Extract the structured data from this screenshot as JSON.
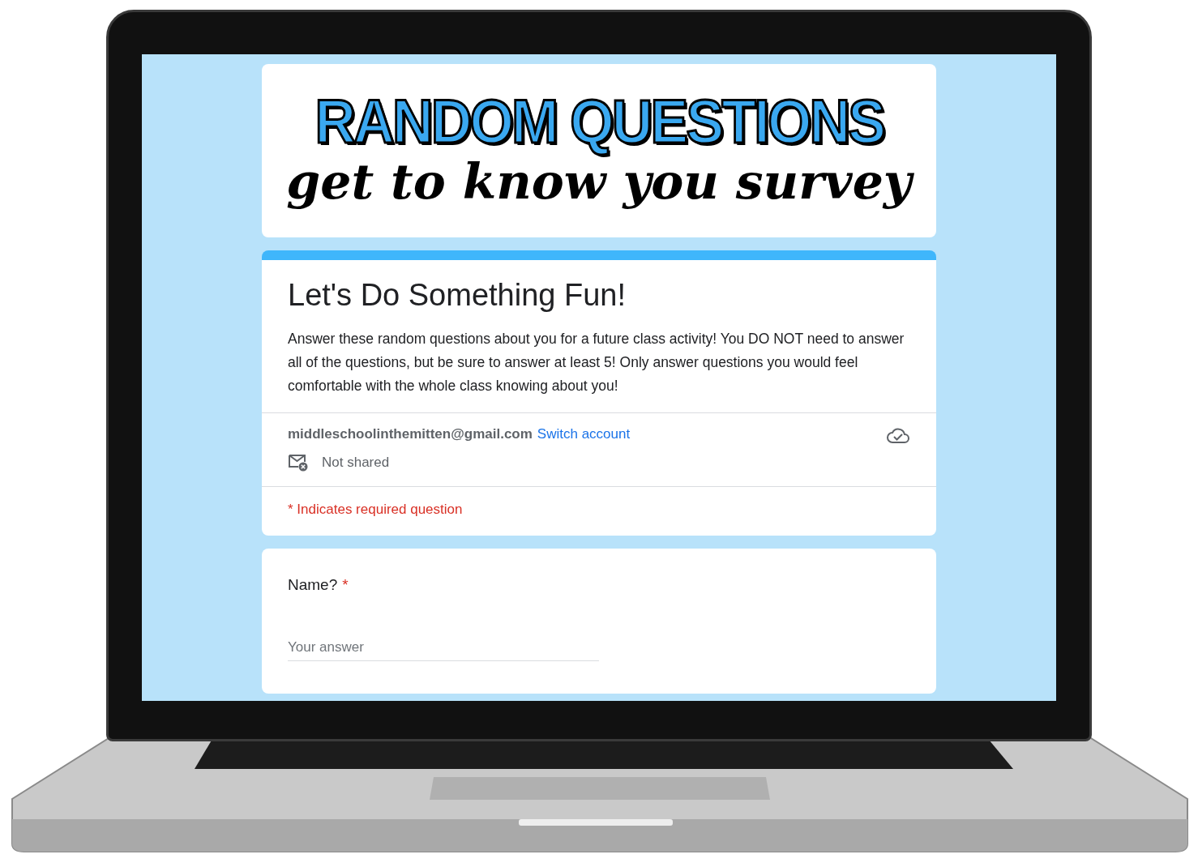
{
  "banner": {
    "title": "RANDOM QUESTIONS",
    "subtitle": "get to know you survey"
  },
  "form": {
    "title": "Let's Do Something Fun!",
    "description": "Answer these random questions about you for a future class activity! You DO NOT need to answer all of the questions, but be sure to answer at least 5! Only answer questions you would feel comfortable with the whole class knowing about you!",
    "account": {
      "email": "middleschoolinthemitten@gmail.com",
      "switch_link": "Switch account",
      "sharing": "Not shared"
    },
    "required_note": "* Indicates required question"
  },
  "questions": [
    {
      "label": "Name?",
      "required": true,
      "required_marker": "*",
      "placeholder": "Your answer"
    }
  ]
}
